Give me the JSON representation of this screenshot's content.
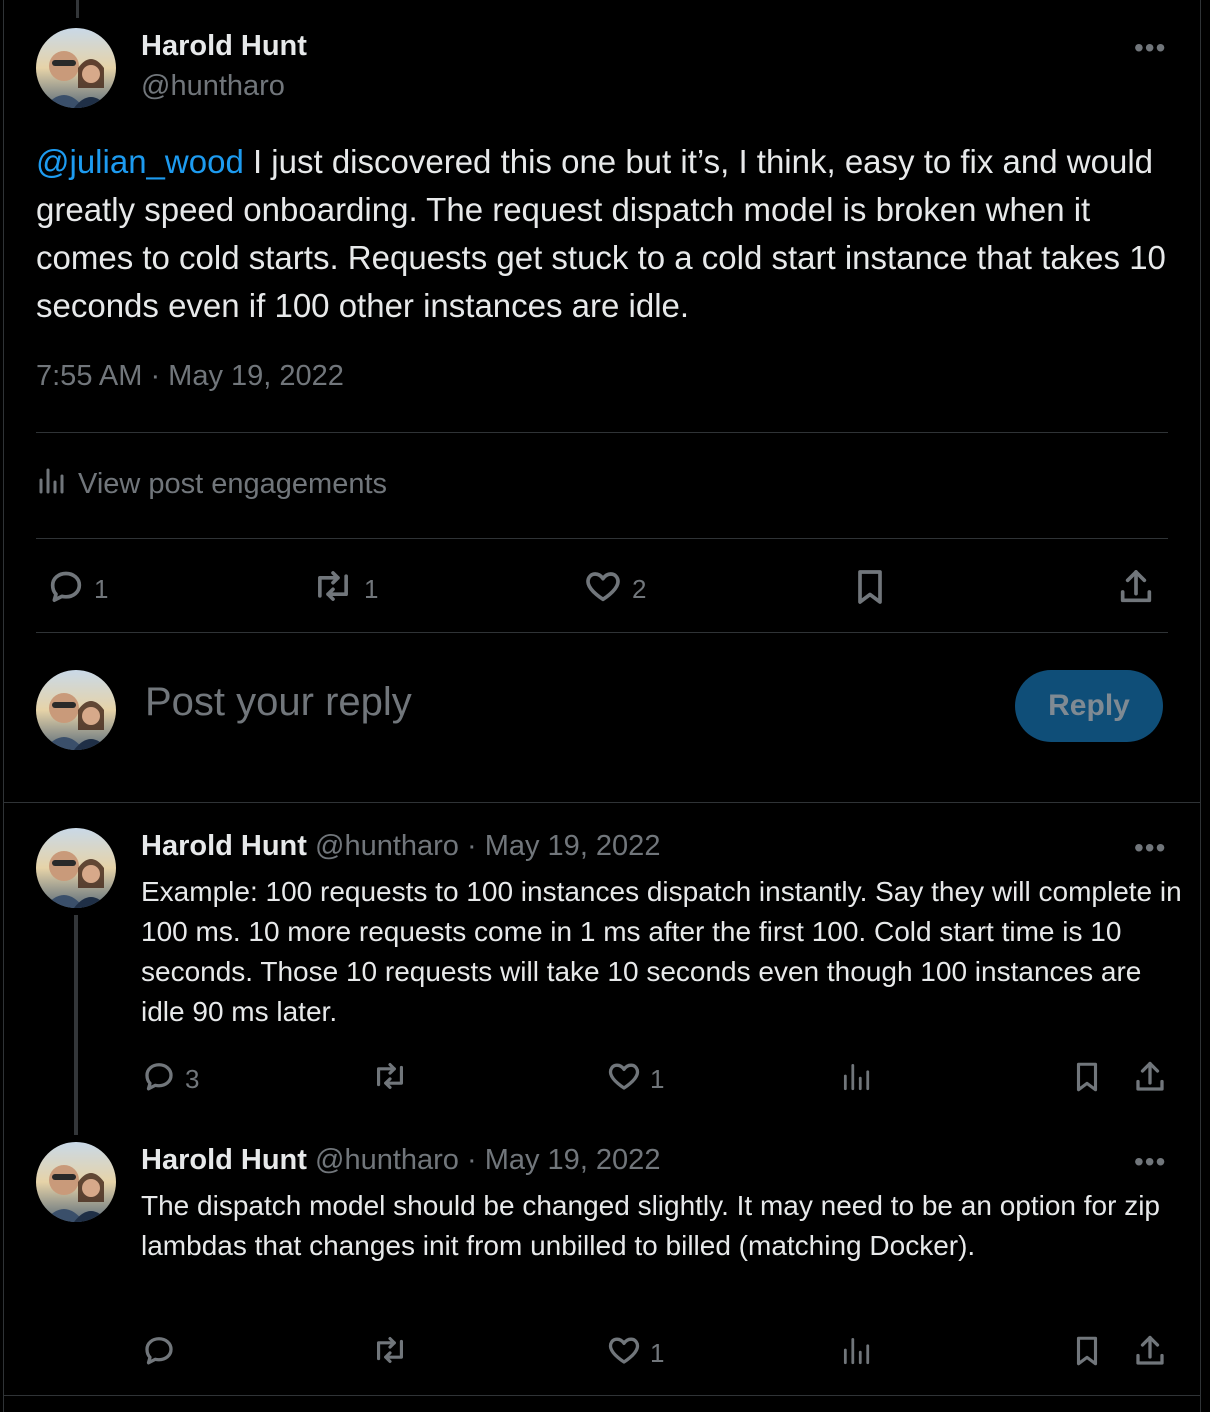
{
  "main_post": {
    "author_name": "Harold Hunt",
    "author_handle": "@huntharo",
    "mention": "@julian_wood",
    "text": " I just discovered this one but it’s, I think, easy to fix and would greatly speed onboarding. The request dispatch model is broken when it comes to cold starts. Requests get stuck to a cold start instance that takes 10 seconds even if 100 other instances are idle.",
    "timestamp": "7:55 AM · May 19, 2022",
    "engagements_label": "View post engagements",
    "stats": {
      "replies": "1",
      "reposts": "1",
      "likes": "2"
    },
    "more": "•••"
  },
  "reply_box": {
    "placeholder": "Post your reply",
    "button_label": "Reply"
  },
  "replies": [
    {
      "author_name": "Harold Hunt",
      "author_handle": "@huntharo",
      "date": "· May 19, 2022",
      "text": "Example: 100 requests to 100 instances dispatch instantly. Say they will complete in 100 ms. 10 more requests come in 1 ms after the first 100. Cold start time is 10 seconds. Those 10 requests will take 10 seconds even though 100 instances are idle 90 ms later.",
      "replies": "3",
      "reposts": "",
      "likes": "1",
      "more": "•••"
    },
    {
      "author_name": "Harold Hunt",
      "author_handle": "@huntharo",
      "date": "· May 19, 2022",
      "text": "The dispatch model should be changed slightly. It may need to be an option for zip lambdas that changes init from unbilled to billed (matching Docker).",
      "replies": "",
      "reposts": "",
      "likes": "1",
      "more": "•••"
    }
  ],
  "colors": {
    "background": "#000000",
    "text": "#e7e9ea",
    "muted": "#71767b",
    "link": "#1d9bf0",
    "reply_button": "#0f4e78",
    "divider": "#2f3336"
  }
}
